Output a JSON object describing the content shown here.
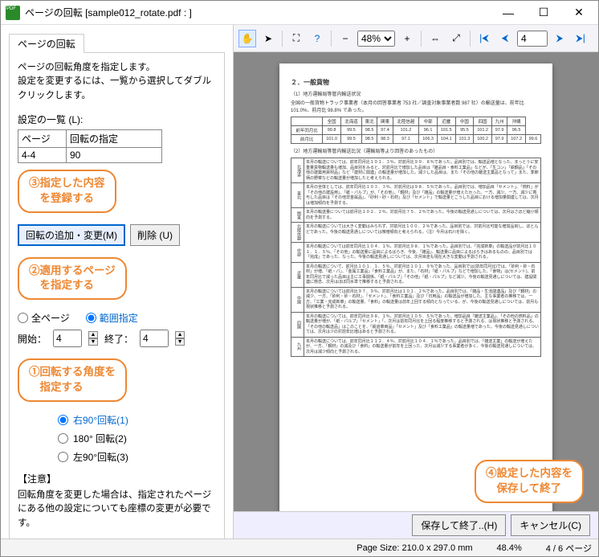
{
  "window": {
    "title": "ページの回転 [sample012_rotate.pdf : ]"
  },
  "tab": {
    "label": "ページの回転"
  },
  "desc": "ページの回転角度を指定します。\n設定を変更するには、一覧から選択してダブルクリックします。",
  "list_label": "設定の一覧 (L):",
  "table": {
    "h1": "ページ",
    "h2": "回転の指定",
    "r1c1": "4-4",
    "r1c2": "90"
  },
  "callouts": {
    "c3": "③指定した内容\n　を登録する",
    "c2": "②適用するページ\n　を指定する",
    "c1": "①回転する角度を\n　指定する",
    "c4": "④設定した内容を\n　保存して終了"
  },
  "buttons": {
    "add": "回転の追加・変更(M)",
    "del": "削除 (U)",
    "save": "保存して終了..(H)",
    "cancel": "キャンセル(C)"
  },
  "scope": {
    "all": "全ページ",
    "range": "範囲指定",
    "start_l": "開始：",
    "start_v": "4",
    "end_l": "終了：",
    "end_v": "4"
  },
  "rotate": {
    "r90": "右90°回転(1)",
    "r180": "180° 回転(2)",
    "l90": "左90°回転(3)"
  },
  "note": {
    "title": "【注意】",
    "body": "回転角度を変更した場合は、指定されたページにある他の設定についても座標の変更が必要です。"
  },
  "toolbar": {
    "zoom": "48%",
    "page": "4"
  },
  "status": {
    "pagesize": "Page Size: 210.0 x 297.0 mm",
    "zoom": "48.4%",
    "page": "4 / 6 ページ"
  },
  "doc": {
    "h1": "２．一般貨物",
    "s1": "（1）地方運輸局等管内輸送状況",
    "s1b": "全国の一般貨物トラック事業者（本月の回答事業者 753 社／調査対象事業者数 987 社）の輸送量は、前年比 101.0%、前月比 98.8% であった。",
    "t_cols": [
      "",
      "全国",
      "北海道",
      "東北",
      "関東",
      "北陸信越",
      "中部",
      "近畿",
      "中国",
      "四国",
      "九州",
      "沖縄"
    ],
    "t_r1": [
      "前年同月比",
      "99.8",
      "99.5",
      "98.5",
      "97.4",
      "101.2",
      "96.1",
      "101.5",
      "95.5",
      "101.2",
      "97.9",
      "96.5"
    ],
    "t_r2": [
      "前月比",
      "101.0",
      "99.5",
      "98.5",
      "98.3",
      "97.1",
      "106.3",
      "104.1",
      "101.3",
      "100.2",
      "97.9",
      "107.2",
      "99.6"
    ],
    "s2": "（2）地方運輸局等管内輸送比況（運輸局等より回答のあったもの）",
    "rows": [
      [
        "北海道",
        "本月の輸送については、前年同月比１０１．３％、対前月比９９．８％であった。品目別では、輸送品増となった、まっとうに安重量貨物輸送量も増加、品目別をみると、対前月比で増加した品目は「雑品目・食料工業品」などが、「生コン」「鉄鋼品」「その他の建築用資材品」など「建材に関連」の輸送量が増加した。減少した品目は、また「その他の雑送主業品となって」また、季節柄の野菜などの輸送量が増加したと考えられる。"
      ],
      [
        "東北",
        "本月の全体としては、前年同月比１０３．３％、対前月比は９８．５％であった。品目別では、増加品目「セメント」、「燃料」が「その他の建設用」、「紙・パルプ」が、「その他」、「鋼材」及び「雑品」の輸送量が増えたかった。一方、減少、一方、減少に寄与した品目は「その他非金属品」、「砂利・砂・石材」及び「セメント」で輸送量とこうした品目における増加量関連しては、次月は増加傾向を予測する。"
      ],
      [
        "関東",
        "本月の輸送量については前月比１０２．２％、対前月比７５．２％であった。今後の輸送見通しについては、次月はさほど縮小傾向を予測する。"
      ],
      [
        "北陸信越",
        "本月の輸送については大きく変動はみられず、対前月比１００．２％であった。品目別では、対前月比可能な増加品目し、ほとんどであった。今後の輸送見通しについては微増傾向と考えられる。（注）今月は石川を除く。"
      ],
      [
        "中部",
        "本月の輸送については前年同月比１０４．１％、対前月比９８．１％であった。品目別では、「完成新車」の輸送品が前月比１０１．１．５％、「その他」の輸送量に品目によるばらき、今後、「雑品」、輸送量に品目によるばらきはあるものの、品目別では「完成」であった、なった。今後の輸送見通しについては、次月目途も現在大きな変動は予測される。"
      ],
      [
        "近畿",
        "本月の輸送について、前月比１０１．１．５％、対前月比１０１．９％であった。品目別では(前年同月比)では、「砂利・砂・石材」が増、「紙・パ」、「金属工業品」「食料工業品」が、また、「石材」「紙・パルプ」などで増加した、「食物」は(セメント)、前年同月比で減った品目は主に工事関係、「紙・パルプ」「その他」「紙・パルプ」など減少。今後の輸送見通しについては、建設関連に懸念、次月はほぼ同水準で推移すると予測される。"
      ],
      [
        "中国",
        "本月の輸送については前月比９７．９％、対前月比は１０１．２％であった。品目別では、「雑品・生活関連品」及び「鋼材」の減少、一方、「砂利・砂・石材」、「セメント」、「食料工業品」及び「日用品」の輸送品が増加した。主な事業者の推移では、一方、「工業・完成新車」の輸送量、「食料」の輸送量は前年上回する傾向となっている、が、今後の輸送見通しについては、前月も現状推移と予測される。"
      ],
      [
        "四国",
        "本月の輸送については、前年同月比９８、１％、対前月比１０５．５％であった、増加品目「雑送主業品」、「その他の燃料品」の輸送量が増が、「紙・パルプ」「セメント」「、次月は前年同月比を上回る程度推移すると予測される、は現状推移と予測される。「その他の輸送品」はこのことを、「鉄道車両品」「セメント」及び「食料工業品」の輸送量増であった。今後の輸送見通しについては、次月は少の対前年比増はあると予測される。"
      ],
      [
        "九州",
        "本月の輸送については、前年同月比１１２．４％、対前月比１０４．１％であった。品目別では、「雑送主業」の輸送が増えたが、一方、「鋼材」の減及び「食料」の輸送量が前年を上回った、次月は減少する事業者が多く、今後の輸送見通しについては、次月は減少傾向と予測される。"
      ]
    ]
  },
  "chart_data": {
    "type": "table",
    "title": "地方運輸局等管内輸送状況",
    "columns": [
      "全国",
      "北海道",
      "東北",
      "関東",
      "北陸信越",
      "中部",
      "近畿",
      "中国",
      "四国",
      "九州",
      "沖縄"
    ],
    "series": [
      {
        "name": "前年同月比",
        "values": [
          99.8,
          99.5,
          98.5,
          97.4,
          101.2,
          96.1,
          101.5,
          95.5,
          101.2,
          97.9,
          96.5
        ]
      },
      {
        "name": "前月比",
        "values": [
          101.0,
          99.5,
          98.5,
          98.3,
          97.1,
          106.3,
          104.1,
          101.3,
          100.2,
          97.9,
          107.2
        ]
      }
    ]
  }
}
